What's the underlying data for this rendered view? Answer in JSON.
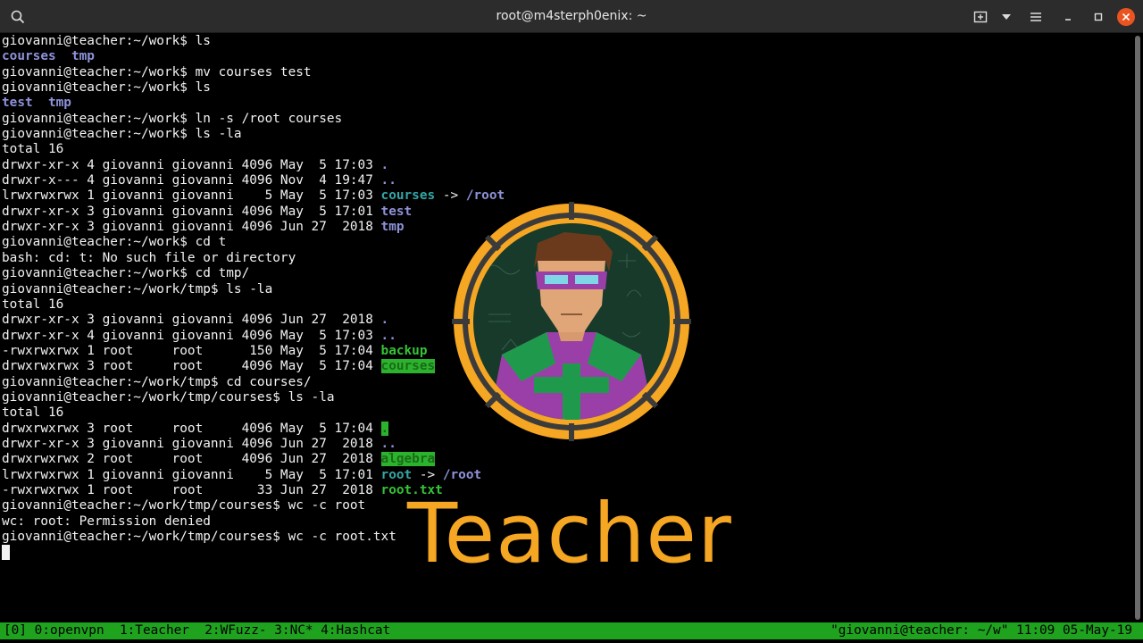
{
  "window": {
    "title": "root@m4sterph0enix: ~"
  },
  "terminal": {
    "lines": [
      [
        {
          "t": "giovanni@teacher:~/work$ ls"
        }
      ],
      [
        {
          "t": "courses",
          "c": "dir"
        },
        {
          "t": "  "
        },
        {
          "t": "tmp",
          "c": "dir"
        }
      ],
      [
        {
          "t": "giovanni@teacher:~/work$ mv courses test"
        }
      ],
      [
        {
          "t": "giovanni@teacher:~/work$ ls"
        }
      ],
      [
        {
          "t": "test",
          "c": "dir"
        },
        {
          "t": "  "
        },
        {
          "t": "tmp",
          "c": "dir"
        }
      ],
      [
        {
          "t": "giovanni@teacher:~/work$ ln -s /root courses"
        }
      ],
      [
        {
          "t": "giovanni@teacher:~/work$ ls -la"
        }
      ],
      [
        {
          "t": "total 16"
        }
      ],
      [
        {
          "t": "drwxr-xr-x 4 giovanni giovanni 4096 May  5 17:03 "
        },
        {
          "t": ".",
          "c": "dir"
        }
      ],
      [
        {
          "t": "drwxr-x--- 4 giovanni giovanni 4096 Nov  4 19:47 "
        },
        {
          "t": "..",
          "c": "dir"
        }
      ],
      [
        {
          "t": "lrwxrwxrwx 1 giovanni giovanni    5 May  5 17:03 "
        },
        {
          "t": "courses",
          "c": "link"
        },
        {
          "t": " -> "
        },
        {
          "t": "/root",
          "c": "dir"
        }
      ],
      [
        {
          "t": "drwxr-xr-x 3 giovanni giovanni 4096 May  5 17:01 "
        },
        {
          "t": "test",
          "c": "dir"
        }
      ],
      [
        {
          "t": "drwxr-xr-x 3 giovanni giovanni 4096 Jun 27  2018 "
        },
        {
          "t": "tmp",
          "c": "dir"
        }
      ],
      [
        {
          "t": "giovanni@teacher:~/work$ cd t"
        }
      ],
      [
        {
          "t": "bash: cd: t: No such file or directory"
        }
      ],
      [
        {
          "t": "giovanni@teacher:~/work$ cd tmp/"
        }
      ],
      [
        {
          "t": "giovanni@teacher:~/work/tmp$ ls -la"
        }
      ],
      [
        {
          "t": "total 16"
        }
      ],
      [
        {
          "t": "drwxr-xr-x 3 giovanni giovanni 4096 Jun 27  2018 "
        },
        {
          "t": ".",
          "c": "dir"
        }
      ],
      [
        {
          "t": "drwxr-xr-x 4 giovanni giovanni 4096 May  5 17:03 "
        },
        {
          "t": "..",
          "c": "dir"
        }
      ],
      [
        {
          "t": "-rwxrwxrwx 1 root     root      150 May  5 17:04 "
        },
        {
          "t": "backup",
          "c": "exe"
        }
      ],
      [
        {
          "t": "drwxrwxrwx 3 root     root     4096 May  5 17:04 "
        },
        {
          "t": "courses",
          "c": "hl"
        }
      ],
      [
        {
          "t": "giovanni@teacher:~/work/tmp$ cd courses/"
        }
      ],
      [
        {
          "t": "giovanni@teacher:~/work/tmp/courses$ ls -la"
        }
      ],
      [
        {
          "t": "total 16"
        }
      ],
      [
        {
          "t": "drwxrwxrwx 3 root     root     4096 May  5 17:04 "
        },
        {
          "t": ".",
          "c": "hl"
        }
      ],
      [
        {
          "t": "drwxr-xr-x 3 giovanni giovanni 4096 Jun 27  2018 "
        },
        {
          "t": "..",
          "c": "dir"
        }
      ],
      [
        {
          "t": "drwxrwxrwx 2 root     root     4096 Jun 27  2018 "
        },
        {
          "t": "algebra",
          "c": "hl"
        }
      ],
      [
        {
          "t": "lrwxrwxrwx 1 giovanni giovanni    5 May  5 17:01 "
        },
        {
          "t": "root",
          "c": "link"
        },
        {
          "t": " -> "
        },
        {
          "t": "/root",
          "c": "dir"
        }
      ],
      [
        {
          "t": "-rwxrwxrwx 1 root     root       33 Jun 27  2018 "
        },
        {
          "t": "root.txt",
          "c": "exe"
        }
      ],
      [
        {
          "t": "giovanni@teacher:~/work/tmp/courses$ wc -c root"
        }
      ],
      [
        {
          "t": "wc: root: Permission denied"
        }
      ],
      [
        {
          "t": "giovanni@teacher:~/work/tmp/courses$ wc -c root.txt"
        }
      ]
    ]
  },
  "overlay": {
    "brand_text": "Teacher"
  },
  "statusbar": {
    "windows": "[0] 0:openvpn  1:Teacher  2:WFuzz- 3:NC* 4:Hashcat",
    "right": "\"giovanni@teacher: ~/w\" 11:09 05-May-19"
  },
  "colors": {
    "titlebar": "#2c2c2c",
    "terminal_bg": "#000000",
    "terminal_fg": "#f2f2f2",
    "directory": "#8e92d8",
    "symlink": "#35a6a6",
    "executable": "#36c236",
    "status_bg": "#1fa31f",
    "brand": "#f5a623",
    "close_button": "#e95420"
  },
  "icons": {
    "search": "search-icon",
    "new_tab": "new-tab-icon",
    "dropdown": "chevron-down-icon",
    "menu": "hamburger-menu-icon",
    "minimize": "minimize-icon",
    "maximize": "maximize-icon",
    "close": "close-icon"
  }
}
